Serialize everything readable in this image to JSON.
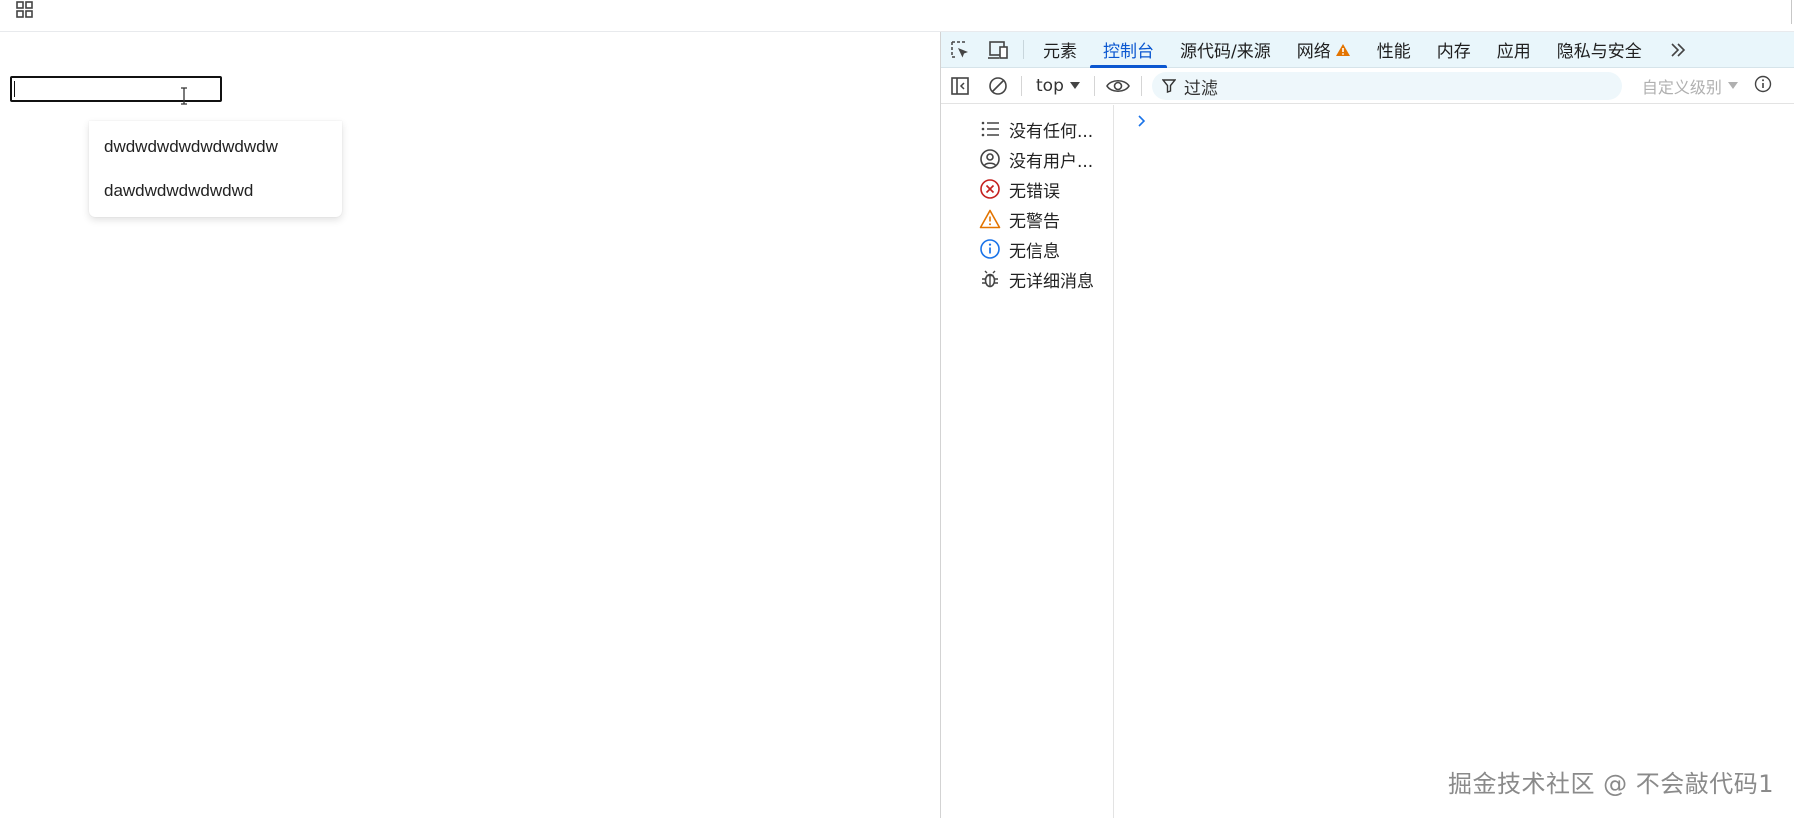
{
  "topbar": {
    "apps_icon": "apps-grid-icon"
  },
  "page": {
    "input": {
      "value": "",
      "placeholder": ""
    },
    "suggestions": [
      "dwdwdwdwdwdwdwdw",
      "dawdwdwdwdwdwd"
    ]
  },
  "devtools": {
    "toolbar_icons": [
      "inspect-element-icon",
      "device-toolbar-icon"
    ],
    "tabs": [
      {
        "label": "元素",
        "active": false
      },
      {
        "label": "控制台",
        "active": true
      },
      {
        "label": "源代码/来源",
        "active": false
      },
      {
        "label": "网络",
        "active": false,
        "warning": true
      },
      {
        "label": "性能",
        "active": false
      },
      {
        "label": "内存",
        "active": false
      },
      {
        "label": "应用",
        "active": false
      },
      {
        "label": "隐私与安全",
        "active": false
      }
    ],
    "more_tabs_label": "»",
    "console_toolbar": {
      "context": "top",
      "filter_placeholder": "过滤",
      "level_label": "自定义级别"
    },
    "sidebar": [
      {
        "label": "没有任何...",
        "icon": "list-icon"
      },
      {
        "label": "没有用户...",
        "icon": "user-icon"
      },
      {
        "label": "无错误",
        "icon": "error-icon"
      },
      {
        "label": "无警告",
        "icon": "warning-icon"
      },
      {
        "label": "无信息",
        "icon": "info-icon"
      },
      {
        "label": "无详细消息",
        "icon": "bug-icon"
      }
    ],
    "prompt_glyph": "›"
  },
  "colors": {
    "accent": "#0b57d0",
    "tabbar_bg": "#e9f6fb",
    "error": "#c5221f",
    "warning": "#e37400",
    "info": "#1a73e8"
  },
  "watermark": "掘金技术社区 @ 不会敲代码1"
}
